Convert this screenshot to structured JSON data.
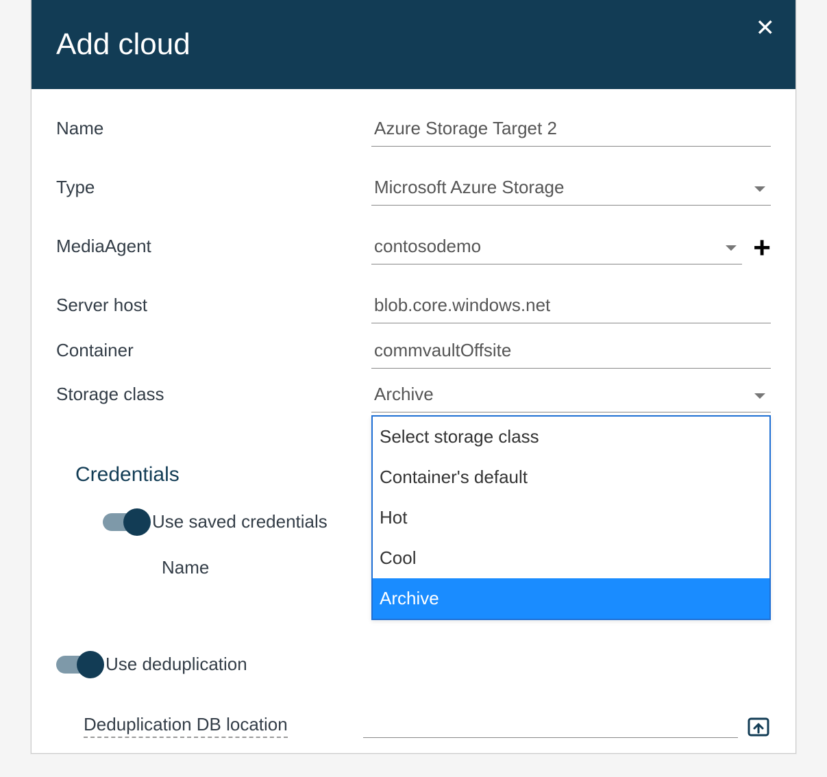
{
  "header": {
    "title": "Add cloud"
  },
  "fields": {
    "name": {
      "label": "Name",
      "value": "Azure Storage Target 2"
    },
    "type": {
      "label": "Type",
      "value": "Microsoft Azure Storage"
    },
    "media_agent": {
      "label": "MediaAgent",
      "value": "contosodemo"
    },
    "server_host": {
      "label": "Server host",
      "value": "blob.core.windows.net"
    },
    "container": {
      "label": "Container",
      "value": "commvaultOffsite"
    },
    "storage_class": {
      "label": "Storage class",
      "value": "Archive",
      "options": [
        "Select storage class",
        "Container's default",
        "Hot",
        "Cool",
        "Archive"
      ],
      "selected_index": 4
    }
  },
  "credentials": {
    "heading": "Credentials",
    "toggle_label": "Use saved credentials",
    "name_label": "Name"
  },
  "dedup": {
    "toggle_label": "Use deduplication",
    "db_label": "Deduplication DB location"
  }
}
